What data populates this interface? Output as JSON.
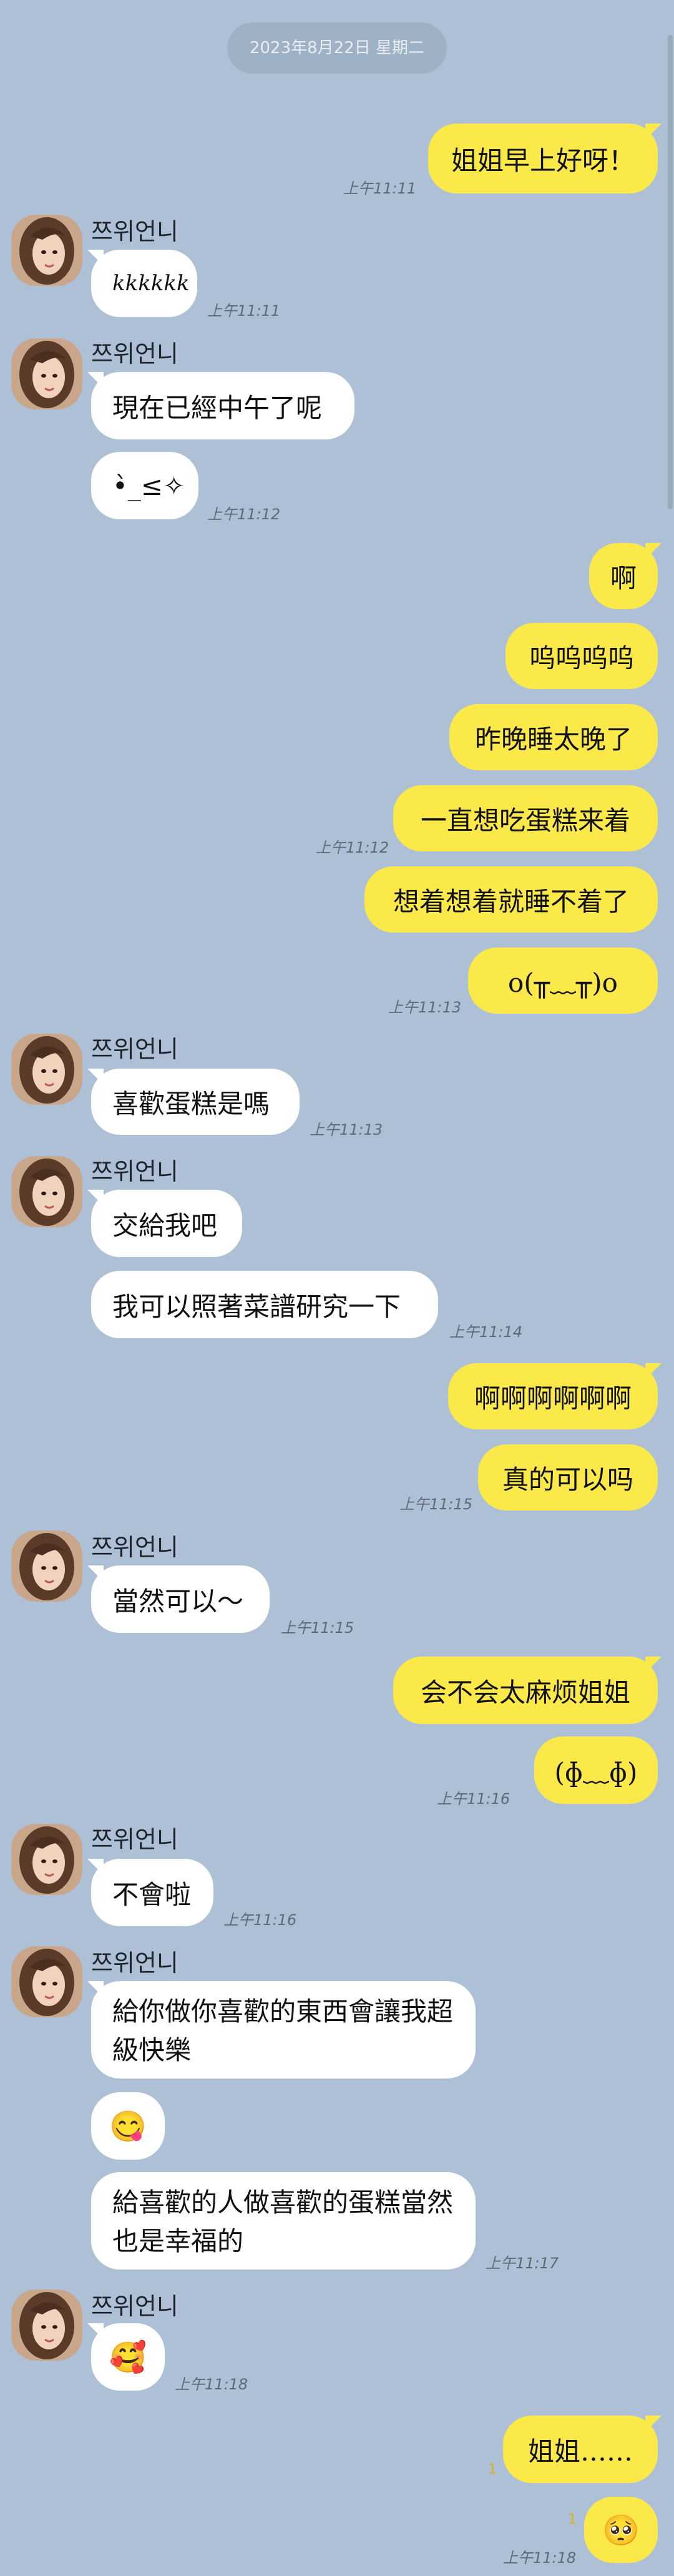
{
  "date_label": "2023年8月22日 星期二",
  "contact_name": "쯔위언니",
  "colors": {
    "background": "#aec0d5",
    "outgoing": "#fbe94a",
    "incoming": "#ffffff"
  },
  "messages": {
    "m1": {
      "text": "姐姐早上好呀！",
      "time": "上午11:11"
    },
    "m2": {
      "text": "kkkkkk",
      "time": "上午11:11"
    },
    "m3": {
      "text": "現在已經中午了呢"
    },
    "m4": {
      "text": "•̀_≤✧",
      "time": "上午11:12"
    },
    "m5": {
      "text": "啊"
    },
    "m6": {
      "text": "呜呜呜呜"
    },
    "m7": {
      "text": "昨晚睡太晚了"
    },
    "m8": {
      "text": "一直想吃蛋糕来着",
      "time": "上午11:12"
    },
    "m9": {
      "text": "想着想着就睡不着了"
    },
    "m10": {
      "text": "o(╥﹏╥)o",
      "time": "上午11:13"
    },
    "m11": {
      "text": "喜歡蛋糕是嗎",
      "time": "上午11:13"
    },
    "m12": {
      "text": "交給我吧"
    },
    "m13": {
      "text": "我可以照著菜譜研究一下",
      "time": "上午11:14"
    },
    "m14": {
      "text": "啊啊啊啊啊啊"
    },
    "m15": {
      "text": "真的可以吗",
      "time": "上午11:15"
    },
    "m16": {
      "text": "當然可以～",
      "time": "上午11:15"
    },
    "m17": {
      "text": "会不会太麻烦姐姐"
    },
    "m18": {
      "text": "(ɸ﹏ɸ)",
      "time": "上午11:16"
    },
    "m19": {
      "text": "不會啦",
      "time": "上午11:16"
    },
    "m20": {
      "text": "給你做你喜歡的東西會讓我超級快樂"
    },
    "m21": {
      "text": "😋"
    },
    "m22": {
      "text": "給喜歡的人做喜歡的蛋糕當然也是幸福的",
      "time": "上午11:17"
    },
    "m23": {
      "text": "🥰",
      "time": "上午11:18"
    },
    "m24": {
      "text": "姐姐……"
    },
    "m25": {
      "text": "🥺",
      "time": "上午11:18"
    }
  }
}
